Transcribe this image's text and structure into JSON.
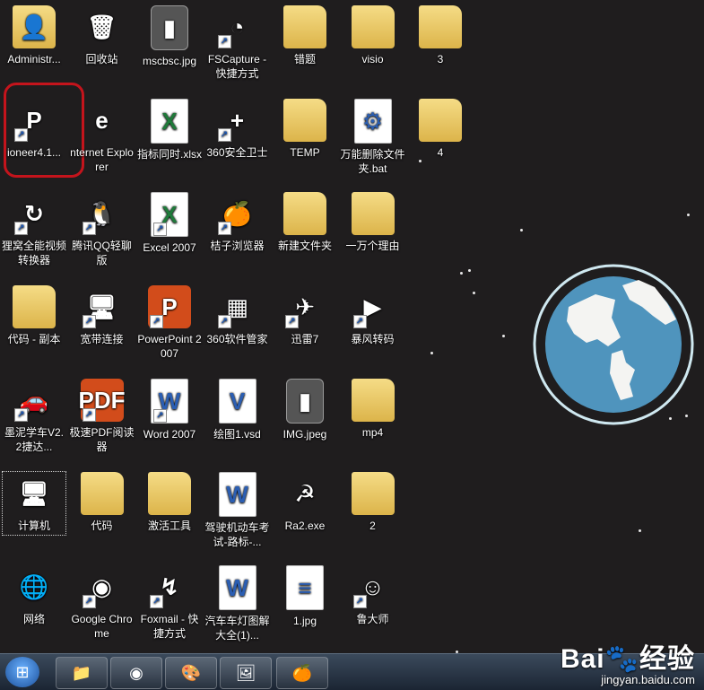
{
  "desktop_icons": [
    {
      "label": "Administr...",
      "glyph": "👤",
      "style": "folder",
      "shortcut": false
    },
    {
      "label": "回收站",
      "glyph": "🗑",
      "style": "plain",
      "shortcut": false
    },
    {
      "label": "mscbsc.jpg",
      "glyph": "▮",
      "style": "img-thumb",
      "shortcut": false
    },
    {
      "label": "FSCapture - 快捷方式",
      "glyph": "◔",
      "style": "plain",
      "shortcut": true
    },
    {
      "label": "错题",
      "glyph": "",
      "style": "folder",
      "shortcut": false
    },
    {
      "label": "visio",
      "glyph": "",
      "style": "folder",
      "shortcut": false
    },
    {
      "label": "3",
      "glyph": "",
      "style": "folder",
      "shortcut": false
    },
    {
      "label": "ioneer4.1...",
      "glyph": "P",
      "style": "round",
      "shortcut": true
    },
    {
      "label": "nternet Explorer",
      "glyph": "e",
      "style": "round",
      "shortcut": false
    },
    {
      "label": "指标同时.xlsx",
      "glyph": "X",
      "style": "xls",
      "shortcut": false
    },
    {
      "label": "360安全卫士",
      "glyph": "+",
      "style": "round",
      "shortcut": true
    },
    {
      "label": "TEMP",
      "glyph": "",
      "style": "folder",
      "shortcut": false
    },
    {
      "label": "万能删除文件夹.bat",
      "glyph": "⚙",
      "style": "doc",
      "shortcut": false
    },
    {
      "label": "4",
      "glyph": "",
      "style": "folder",
      "shortcut": false
    },
    {
      "label": "狸窝全能视频转换器",
      "glyph": "↻",
      "style": "round",
      "shortcut": true
    },
    {
      "label": "腾讯QQ轻聊版",
      "glyph": "🐧",
      "style": "plain",
      "shortcut": true
    },
    {
      "label": "Excel 2007",
      "glyph": "X",
      "style": "xls",
      "shortcut": true
    },
    {
      "label": "桔子浏览器",
      "glyph": "🍊",
      "style": "plain",
      "shortcut": true
    },
    {
      "label": "新建文件夹",
      "glyph": "",
      "style": "folder",
      "shortcut": false
    },
    {
      "label": "一万个理由",
      "glyph": "",
      "style": "folder",
      "shortcut": false
    },
    {
      "label": "代码 - 副本",
      "glyph": "",
      "style": "folder",
      "shortcut": false
    },
    {
      "label": "宽带连接",
      "glyph": "🖥",
      "style": "plain",
      "shortcut": true
    },
    {
      "label": "PowerPoint 2007",
      "glyph": "P",
      "style": "ppt",
      "shortcut": true
    },
    {
      "label": "360软件管家",
      "glyph": "▦",
      "style": "plain",
      "shortcut": true
    },
    {
      "label": "迅雷7",
      "glyph": "✈",
      "style": "plain",
      "shortcut": true
    },
    {
      "label": "暴风转码",
      "glyph": "▶",
      "style": "plain",
      "shortcut": true
    },
    {
      "label": "墨泥学车V2.2捷达...",
      "glyph": "🚗",
      "style": "plain",
      "shortcut": true
    },
    {
      "label": "极速PDF阅读器",
      "glyph": "PDF",
      "style": "ppt",
      "shortcut": true
    },
    {
      "label": "Word 2007",
      "glyph": "W",
      "style": "doc",
      "shortcut": true
    },
    {
      "label": "绘图1.vsd",
      "glyph": "V",
      "style": "doc",
      "shortcut": false
    },
    {
      "label": "IMG.jpeg",
      "glyph": "▮",
      "style": "img-thumb",
      "shortcut": false
    },
    {
      "label": "mp4",
      "glyph": "",
      "style": "folder",
      "shortcut": false
    },
    {
      "label": "计算机",
      "glyph": "🖥",
      "style": "plain",
      "shortcut": false
    },
    {
      "label": "代码",
      "glyph": "",
      "style": "folder",
      "shortcut": false
    },
    {
      "label": "激活工具",
      "glyph": "",
      "style": "folder",
      "shortcut": false
    },
    {
      "label": "驾驶机动车考试-路标-...",
      "glyph": "W",
      "style": "doc",
      "shortcut": false
    },
    {
      "label": "Ra2.exe",
      "glyph": "☭",
      "style": "plain",
      "shortcut": false
    },
    {
      "label": "2",
      "glyph": "",
      "style": "folder",
      "shortcut": false
    },
    {
      "label": "网络",
      "glyph": "🌐",
      "style": "plain",
      "shortcut": false
    },
    {
      "label": "Google Chrome",
      "glyph": "◉",
      "style": "round",
      "shortcut": true
    },
    {
      "label": "Foxmail - 快捷方式",
      "glyph": "↯",
      "style": "plain",
      "shortcut": true
    },
    {
      "label": "汽车车灯图解大全(1)...",
      "glyph": "W",
      "style": "doc",
      "shortcut": false
    },
    {
      "label": "1.jpg",
      "glyph": "≡",
      "style": "doc",
      "shortcut": false
    },
    {
      "label": "鲁大师",
      "glyph": "☺",
      "style": "plain",
      "shortcut": true
    }
  ],
  "taskbar": {
    "start_glyph": "⊞",
    "buttons": [
      {
        "name": "explorer",
        "glyph": "📁"
      },
      {
        "name": "chrome",
        "glyph": "◉"
      },
      {
        "name": "paint",
        "glyph": "🎨"
      },
      {
        "name": "picture-viewer",
        "glyph": "🖼"
      },
      {
        "name": "orange-browser",
        "glyph": "🍊"
      }
    ]
  },
  "watermark": {
    "logo": "Bai🐾经验",
    "url": "jingyan.baidu.com"
  },
  "colors": {
    "desktop_bg": "#1f1d1e",
    "highlight_ring": "#c4141c",
    "globe_blue": "#4f94bd"
  }
}
